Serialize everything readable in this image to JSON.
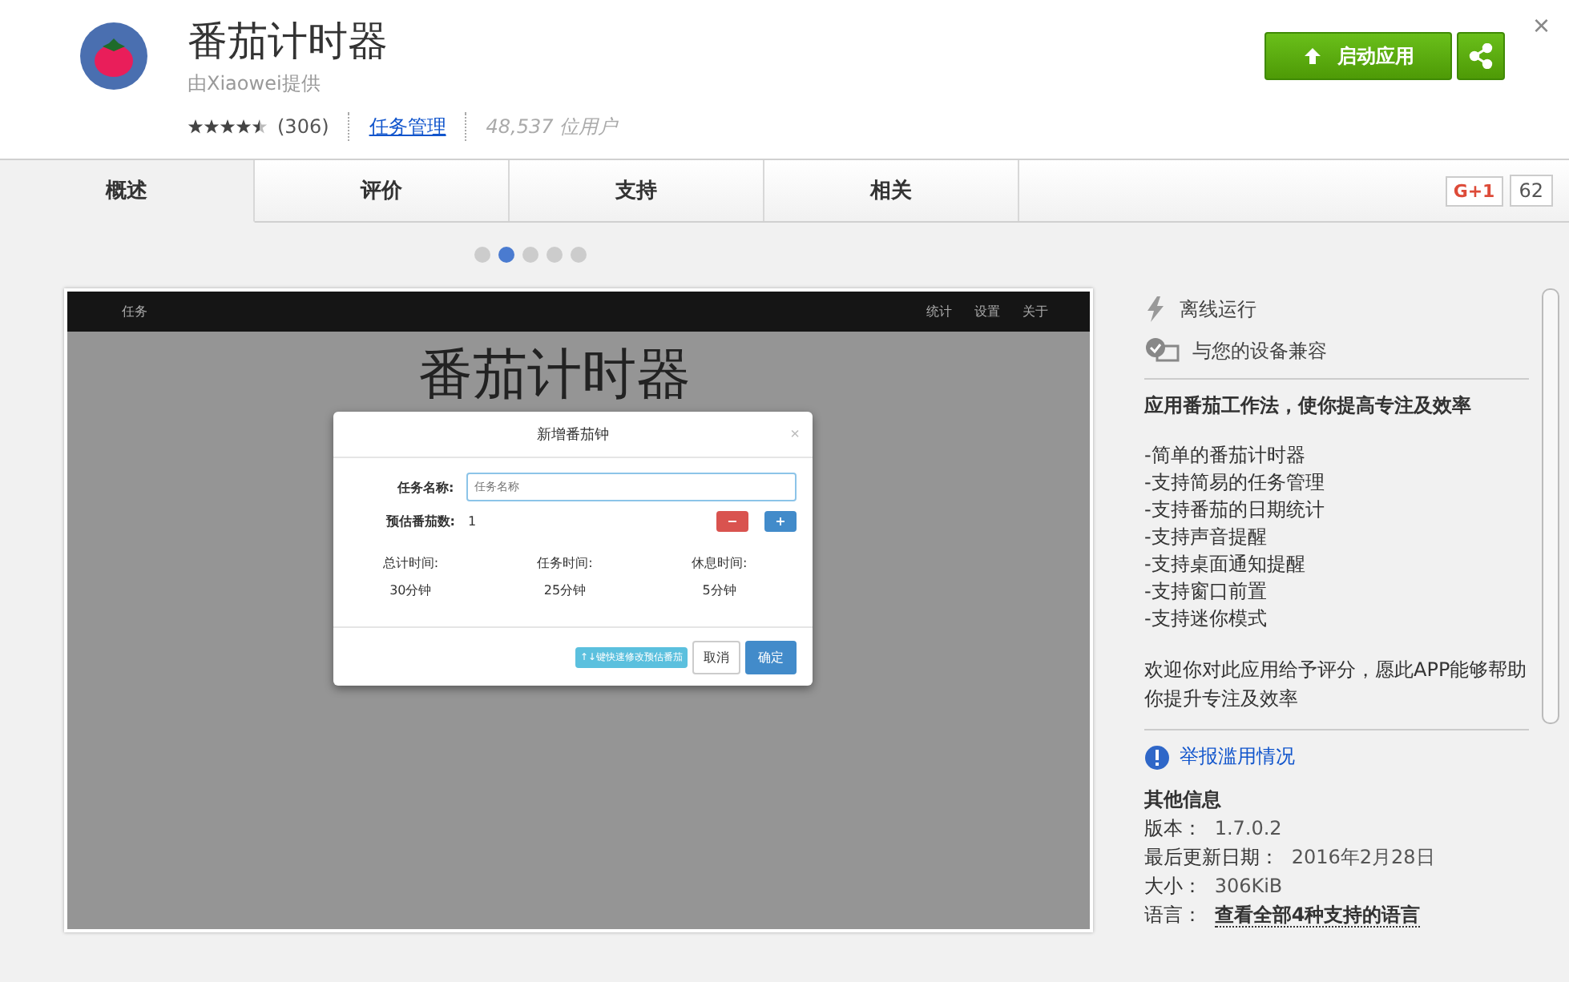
{
  "app": {
    "title": "番茄计时器",
    "provider": "由Xiaowei提供",
    "stars": 4.5,
    "rating_count": "(306)",
    "category": "任务管理",
    "users": "48,537 位用户",
    "launch_button": "启动应用",
    "close": "×"
  },
  "tabs": [
    {
      "label": "概述",
      "selected": true
    },
    {
      "label": "评价",
      "selected": false
    },
    {
      "label": "支持",
      "selected": false
    },
    {
      "label": "相关",
      "selected": false
    }
  ],
  "gplus": {
    "label": "G+1",
    "count": "62"
  },
  "carousel": [
    {
      "selected": false
    },
    {
      "selected": true
    },
    {
      "selected": false
    },
    {
      "selected": false
    },
    {
      "selected": false
    }
  ],
  "screenshot": {
    "nav_left": "任务",
    "nav_right": [
      "统计",
      "设置",
      "关于"
    ],
    "heading": "番茄计时器",
    "dialog": {
      "title": "新增番茄钟",
      "close": "×",
      "name_label": "任务名称:",
      "name_placeholder": "任务名称",
      "count_label": "预估番茄数:",
      "count": "1",
      "minus": "−",
      "plus": "+",
      "stats": [
        {
          "label": "总计时间:",
          "value": "30分钟"
        },
        {
          "label": "任务时间:",
          "value": "25分钟"
        },
        {
          "label": "休息时间:",
          "value": "5分钟"
        }
      ],
      "hint": "↑↓键快速修改预估番茄",
      "cancel": "取消",
      "ok": "确定"
    }
  },
  "features": [
    {
      "kind": "offline",
      "label": "离线运行"
    },
    {
      "kind": "compatible",
      "label": "与您的设备兼容"
    }
  ],
  "description": {
    "headline": "应用番茄工作法，使你提高专注及效率",
    "items": [
      "-简单的番茄计时器",
      "-支持简易的任务管理",
      "-支持番茄的日期统计",
      "-支持声音提醒",
      "-支持桌面通知提醒",
      "-支持窗口前置",
      "-支持迷你模式"
    ],
    "closing": "欢迎你对此应用给予评分，愿此APP能够帮助你提升专注及效率"
  },
  "report": "举报滥用情况",
  "other_info": {
    "title": "其他信息",
    "rows": [
      {
        "label": "版本：",
        "value": "1.7.0.2",
        "kind": "text"
      },
      {
        "label": "最后更新日期：",
        "value": "2016年2月28日",
        "kind": "text"
      },
      {
        "label": "大小：",
        "value": "306KiB",
        "kind": "text"
      },
      {
        "label": "语言：",
        "value": "查看全部4种支持的语言",
        "kind": "link"
      }
    ]
  }
}
